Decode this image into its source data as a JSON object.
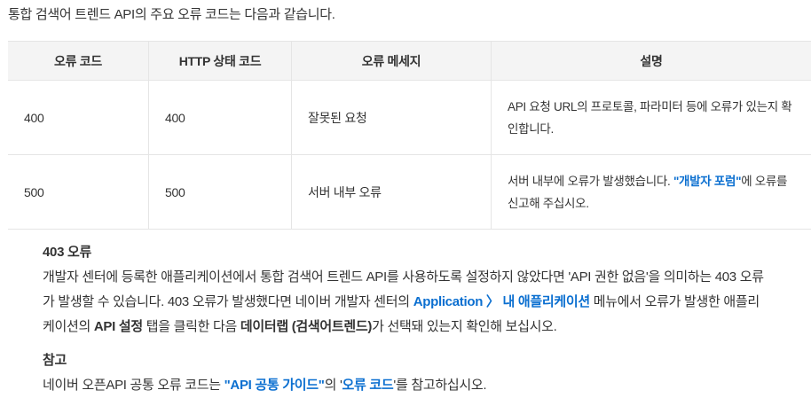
{
  "intro": "통합 검색어 트렌드 API의 주요 오류 코드는 다음과 같습니다.",
  "table": {
    "headers": [
      "오류 코드",
      "HTTP 상태 코드",
      "오류 메세지",
      "설명"
    ],
    "rows": [
      {
        "code": "400",
        "http": "400",
        "message": "잘못된 요청",
        "desc": "API 요청 URL의 프로토콜, 파라미터 등에 오류가 있는지 확인합니다."
      },
      {
        "code": "500",
        "http": "500",
        "message": "서버 내부 오류",
        "desc_pre": "서버 내부에 오류가 발생했습니다. ",
        "desc_link": "\"개발자 포럼\"",
        "desc_post": "에 오류를 신고해 주십시오."
      }
    ]
  },
  "note403": {
    "title": "403 오류",
    "p1": "개발자 센터에 등록한 애플리케이션에서 통합 검색어 트렌드 API를 사용하도록 설정하지 않았다면 'API 권한 없음'을 의미하는 403 오류가 발생할 수 있습니다. 403 오류가 발생했다면 네이버 개발자 센터의 ",
    "link": "Application 〉 내 애플리케이션",
    "p2": " 메뉴에서 오류가 발생한 애플리케이션의 ",
    "bold1": "API 설정",
    "p3": " 탭을 클릭한 다음 ",
    "bold2": "데이터랩 (검색어트렌드)",
    "p4": "가 선택돼 있는지 확인해 보십시오."
  },
  "reference": {
    "title": "참고",
    "pre": "네이버 오픈API 공통 오류 코드는 ",
    "link1": "\"API 공통 가이드\"",
    "mid": "의 '",
    "link2": "오류 코드",
    "post": "'를 참고하십시오."
  }
}
